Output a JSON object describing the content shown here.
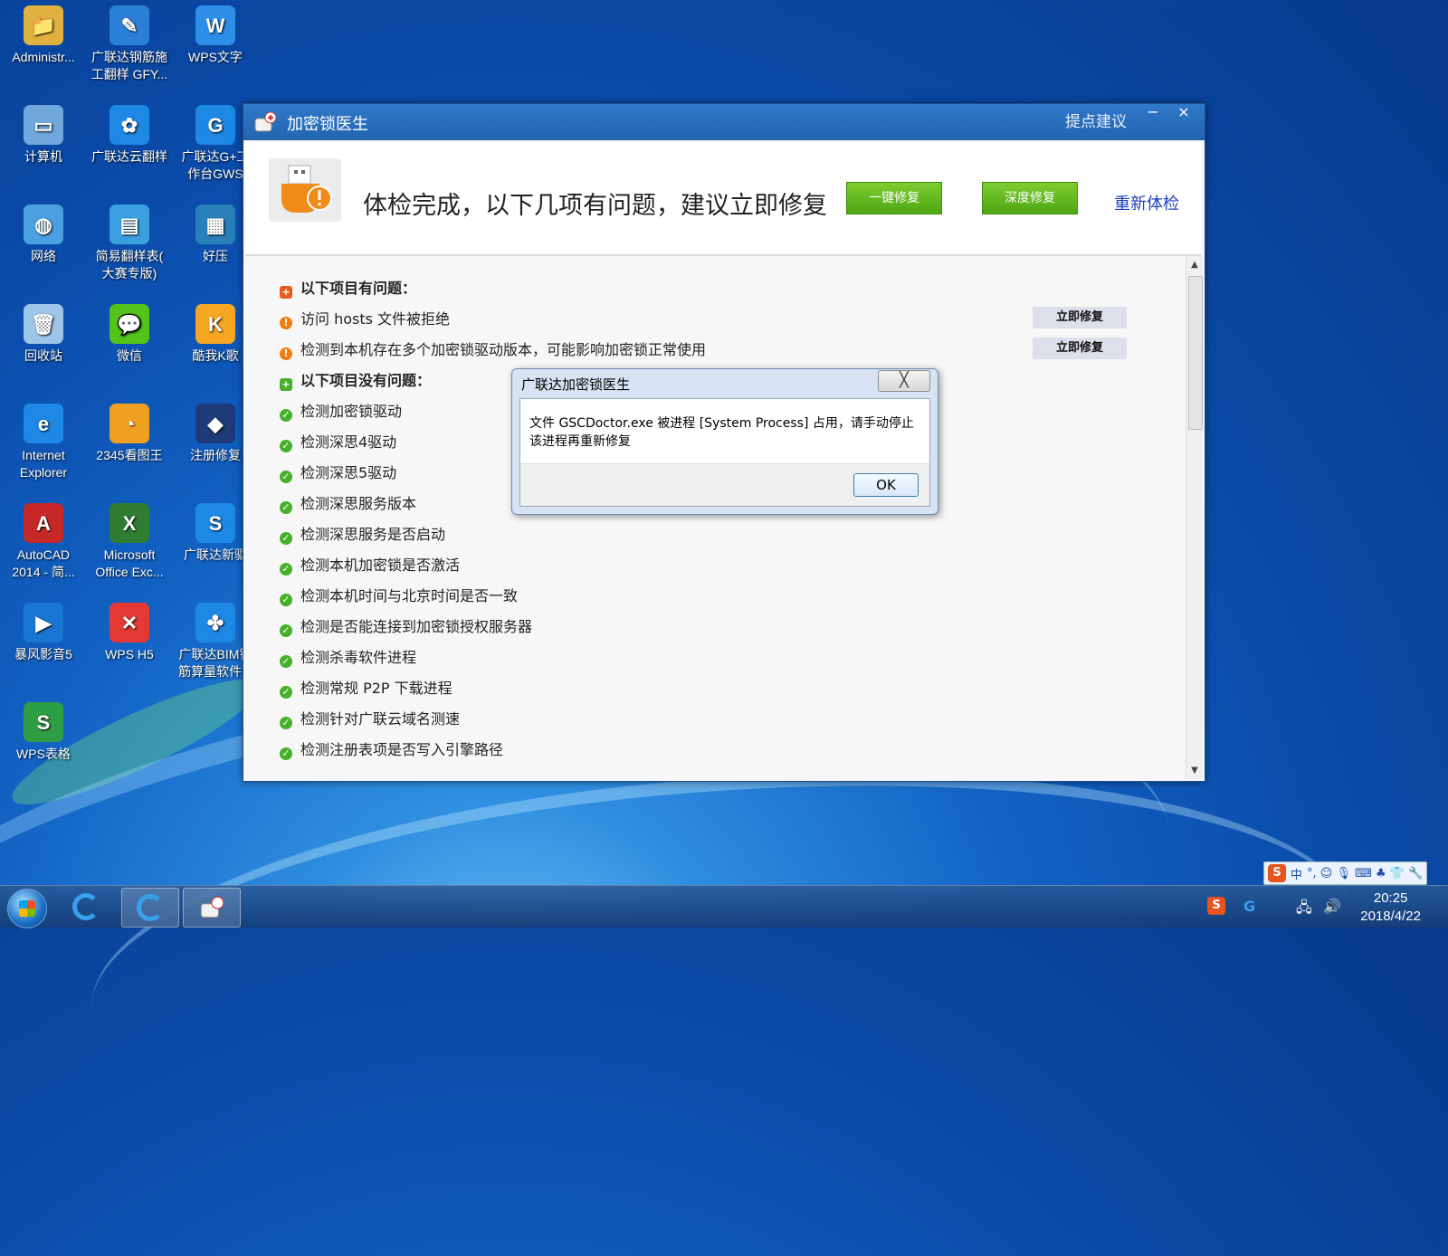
{
  "desktop": {
    "icons": [
      {
        "label": "Administr...",
        "color": "#e0b040",
        "glyph": "📁"
      },
      {
        "label": "广联达钢筋施\n工翻样 GFY...",
        "color": "#2b7fd6",
        "glyph": "✎"
      },
      {
        "label": "WPS文字",
        "color": "#2d8fe8",
        "glyph": "W"
      },
      {
        "label": "计算机",
        "color": "#6fa8dc",
        "glyph": "▭"
      },
      {
        "label": "广联达云翻样",
        "color": "#1e88e5",
        "glyph": "✿"
      },
      {
        "label": "广联达G+工\n作台GWS",
        "color": "#1e88e5",
        "glyph": "G"
      },
      {
        "label": "网络",
        "color": "#4aa0e0",
        "glyph": "◍"
      },
      {
        "label": "简易翻样表(\n大赛专版)",
        "color": "#3aa0e0",
        "glyph": "▤"
      },
      {
        "label": "好压",
        "color": "#2980b9",
        "glyph": "▦"
      },
      {
        "label": "回收站",
        "color": "#9ec5e8",
        "glyph": "🗑"
      },
      {
        "label": "微信",
        "color": "#52c41a",
        "glyph": "💬"
      },
      {
        "label": "酷我K歌",
        "color": "#f5a623",
        "glyph": "K"
      },
      {
        "label": "Internet\nExplorer",
        "color": "#1e88e5",
        "glyph": "e"
      },
      {
        "label": "2345看图王",
        "color": "#f0a020",
        "glyph": "◔"
      },
      {
        "label": "注册修复",
        "color": "#1e3a78",
        "glyph": "◆"
      },
      {
        "label": "AutoCAD\n2014 - 简...",
        "color": "#c62828",
        "glyph": "A"
      },
      {
        "label": "Microsoft\nOffice Exc...",
        "color": "#2e7d32",
        "glyph": "X"
      },
      {
        "label": "广联达新驱",
        "color": "#1e88e5",
        "glyph": "S"
      },
      {
        "label": "暴风影音5",
        "color": "#1976d2",
        "glyph": "▶"
      },
      {
        "label": "WPS H5",
        "color": "#e53935",
        "glyph": "✕"
      },
      {
        "label": "广联达BIM钢\n筋算量软件...",
        "color": "#1e88e5",
        "glyph": "✤"
      },
      {
        "label": "WPS表格",
        "color": "#2e9e44",
        "glyph": "S"
      }
    ]
  },
  "window": {
    "title": "加密锁医生",
    "suggest_label": "提点建议",
    "minimize_glyph": "−",
    "close_glyph": "×",
    "headline": "体检完成，以下几项有问题，建议立即修复",
    "one_click_fix_label": "一键修复",
    "deep_fix_label": "深度修复",
    "recheck_label": "重新体检",
    "problem_section_title": "以下项目有问题：",
    "problems": [
      {
        "text": "访问 hosts 文件被拒绝",
        "fix_label": "立即修复"
      },
      {
        "text": "检测到本机存在多个加密锁驱动版本，可能影响加密锁正常使用",
        "fix_label": "立即修复"
      }
    ],
    "ok_section_title": "以下项目没有问题：",
    "ok_items": [
      "检测加密锁驱动",
      "检测深思4驱动",
      "检测深思5驱动",
      "检测深思服务版本",
      "检测深思服务是否启动",
      "检测本机加密锁是否激活",
      "检测本机时间与北京时间是否一致",
      "检测是否能连接到加密锁授权服务器",
      "检测杀毒软件进程",
      "检测常规 P2P 下载进程",
      "检测针对广联云域名测速",
      "检测注册表项是否写入引擎路径"
    ]
  },
  "dialog": {
    "title": "广联达加密锁医生",
    "close_glyph": "╳",
    "message": "文件 GSCDoctor.exe 被进程 [System Process] 占用，请手动停止该进程再重新修复",
    "ok_label": "OK"
  },
  "taskbar": {
    "time": "20:25",
    "date": "2018/4/22",
    "ime_label": "中",
    "ime_extras": "°, ☺ 🎙 ⌨ ♣ 👕 🔧"
  }
}
